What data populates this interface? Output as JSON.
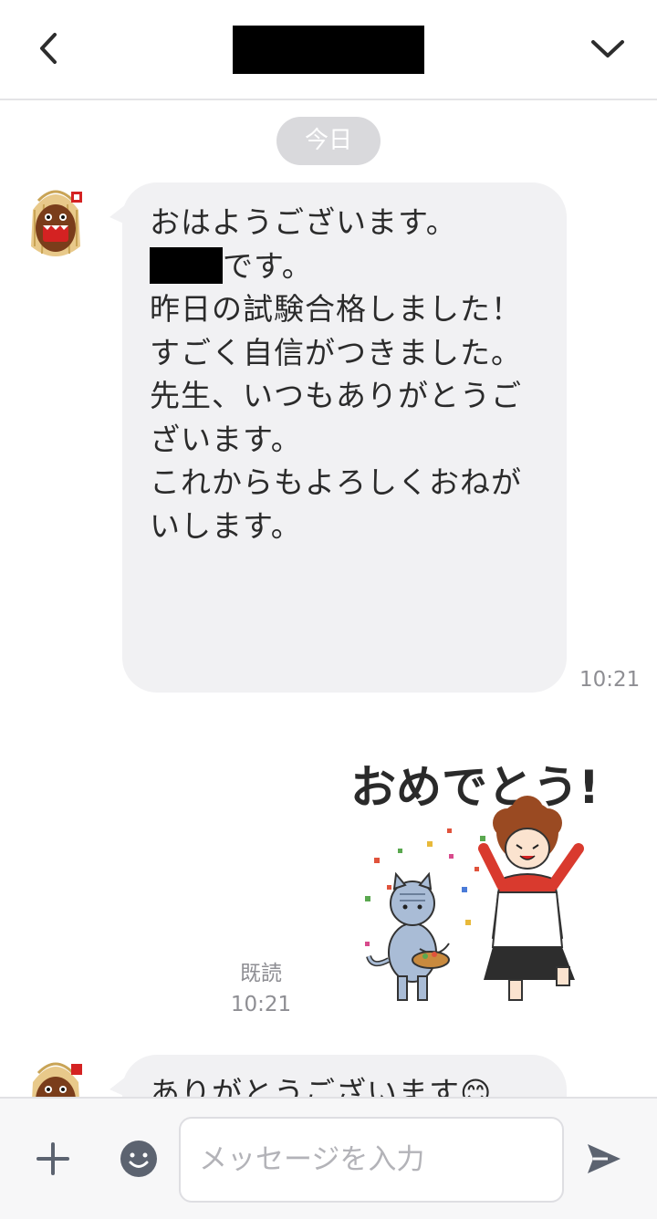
{
  "header": {
    "back_icon": "chevron-left-icon",
    "menu_icon": "chevron-down-icon"
  },
  "chat": {
    "date_divider": "今日",
    "messages": [
      {
        "sender": "incoming",
        "avatar": "mascot-avatar",
        "text_line1_after_redaction": "です。",
        "text_main_1": "おはようございます。",
        "text_main_2": "昨日の試験合格しました！\nすごく自信がつきました。\n先生、いつもありがとうございます。\nこれからもよろしくおねがいします。",
        "time": "10:21"
      },
      {
        "sender": "outgoing",
        "sticker_text": "おめでとう!",
        "read_label": "既読",
        "time": "10:21"
      },
      {
        "sender": "incoming",
        "avatar": "mascot-avatar",
        "text": "ありがとうございます😊"
      }
    ]
  },
  "input_bar": {
    "placeholder": "メッセージを入力",
    "plus_icon": "plus-icon",
    "emoji_icon": "emoji-icon",
    "send_icon": "send-icon"
  },
  "colors": {
    "bubble_incoming": "#f1f1f3",
    "date_pill": "#d9d9dc",
    "icon_gray": "#5c6370"
  }
}
